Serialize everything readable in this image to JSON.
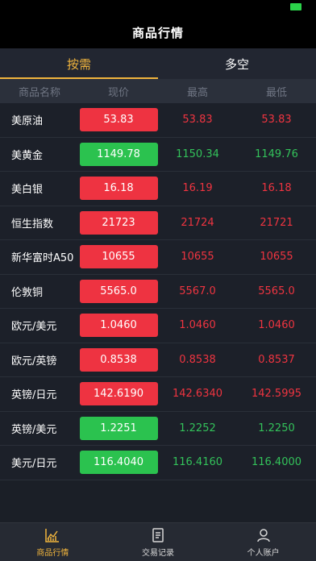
{
  "nav": {
    "title": "商品行情"
  },
  "tabs": [
    {
      "label": "按需",
      "active": true
    },
    {
      "label": "多空",
      "active": false
    }
  ],
  "columns": [
    "商品名称",
    "现价",
    "最高",
    "最低"
  ],
  "rows": [
    {
      "name": "美原油",
      "price": "53.83",
      "high": "53.83",
      "low": "53.83",
      "color": "red"
    },
    {
      "name": "美黄金",
      "price": "1149.78",
      "high": "1150.34",
      "low": "1149.76",
      "color": "green"
    },
    {
      "name": "美白银",
      "price": "16.18",
      "high": "16.19",
      "low": "16.18",
      "color": "red"
    },
    {
      "name": "恒生指数",
      "price": "21723",
      "high": "21724",
      "low": "21721",
      "color": "red"
    },
    {
      "name": "新华富时A50",
      "price": "10655",
      "high": "10655",
      "low": "10655",
      "color": "red"
    },
    {
      "name": "伦敦铜",
      "price": "5565.0",
      "high": "5567.0",
      "low": "5565.0",
      "color": "red"
    },
    {
      "name": "欧元/美元",
      "price": "1.0460",
      "high": "1.0460",
      "low": "1.0460",
      "color": "red"
    },
    {
      "name": "欧元/英镑",
      "price": "0.8538",
      "high": "0.8538",
      "low": "0.8537",
      "color": "red"
    },
    {
      "name": "英镑/日元",
      "price": "142.6190",
      "high": "142.6340",
      "low": "142.5995",
      "color": "red"
    },
    {
      "name": "英镑/美元",
      "price": "1.2251",
      "high": "1.2252",
      "low": "1.2250",
      "color": "green"
    },
    {
      "name": "美元/日元",
      "price": "116.4040",
      "high": "116.4160",
      "low": "116.4000",
      "color": "green"
    }
  ],
  "tabbar": [
    {
      "label": "商品行情",
      "icon": "chart-icon",
      "active": true
    },
    {
      "label": "交易记录",
      "icon": "document-icon",
      "active": false
    },
    {
      "label": "个人账户",
      "icon": "person-icon",
      "active": false
    }
  ],
  "colors": {
    "accent": "#f0b43d",
    "up_red": "#ee3341",
    "down_green": "#2bc24f",
    "background": "#1b1f27"
  }
}
